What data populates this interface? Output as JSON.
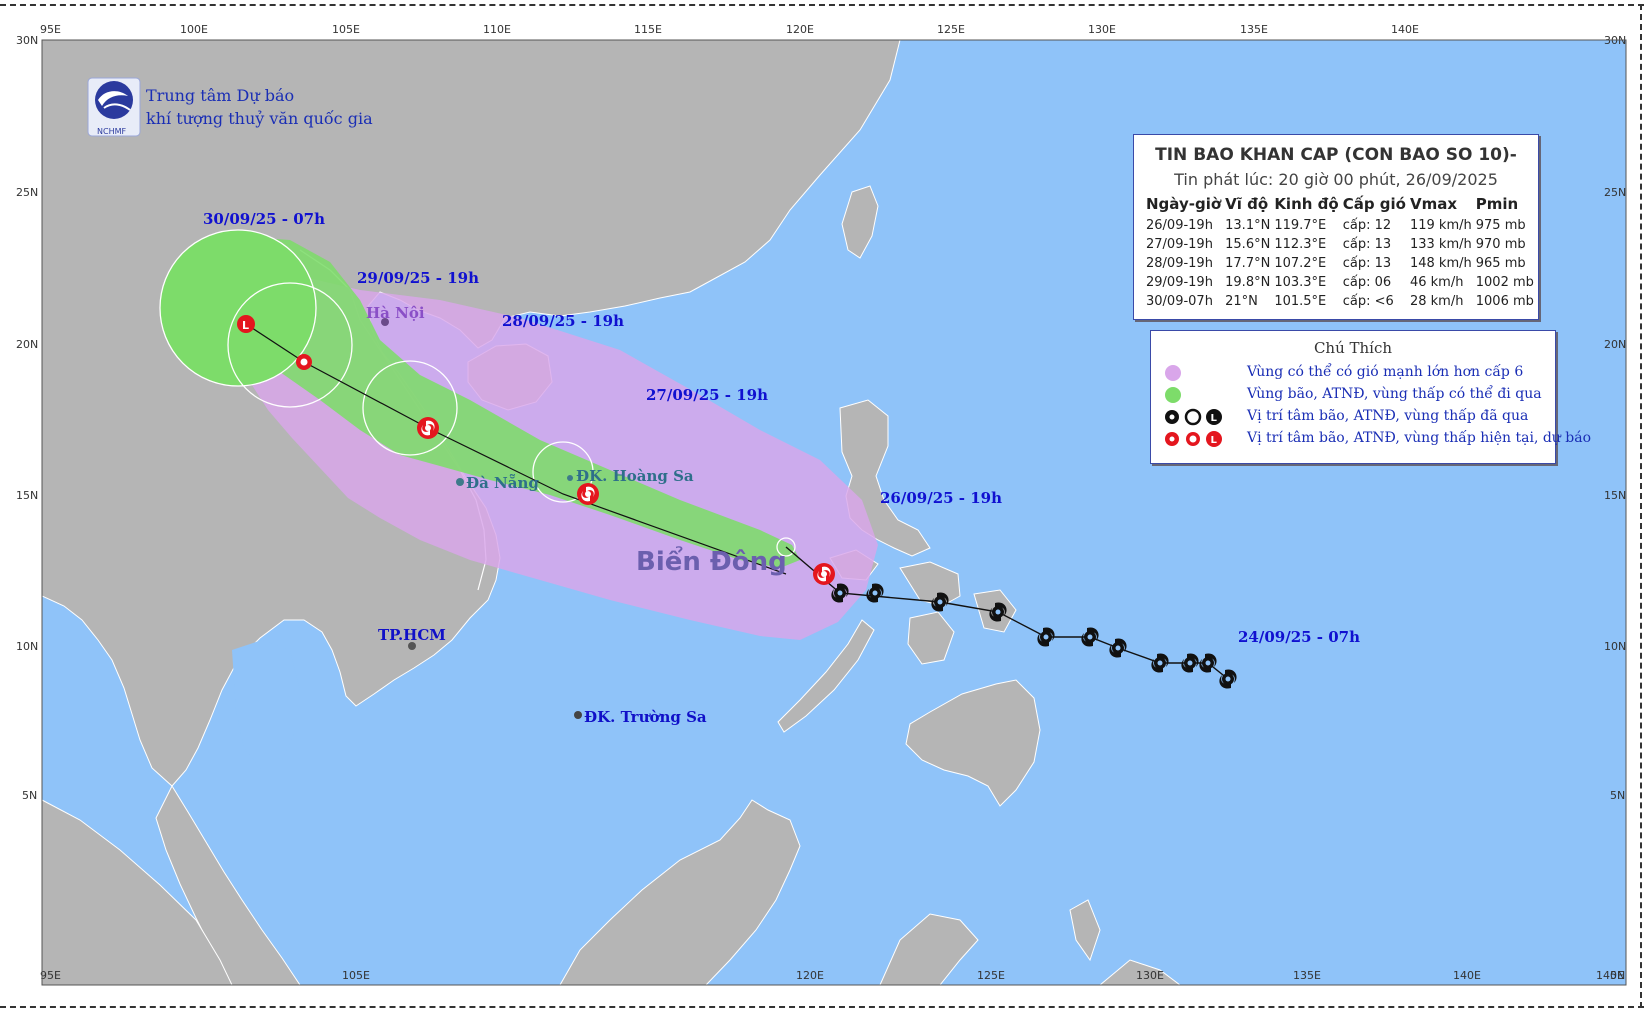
{
  "agency": {
    "line1": "Trung tâm Dự báo",
    "line2": "khí tượng thuỷ văn quốc gia",
    "logo_text": "NCHMF"
  },
  "axes": {
    "lon_ticks": [
      "95E",
      "100E",
      "105E",
      "110E",
      "115E",
      "120E",
      "125E",
      "130E",
      "135E",
      "140E"
    ],
    "lat_ticks_left": [
      "30N",
      "25N",
      "20N",
      "15N",
      "10N",
      "5N"
    ],
    "lat_ticks_right": [
      "30N",
      "25N",
      "20N",
      "15N",
      "10N",
      "5N",
      "0N"
    ],
    "bottom_ticks": [
      "95E",
      "105E",
      "120E",
      "125E",
      "130E",
      "135E",
      "140E",
      "145E"
    ]
  },
  "bulletin": {
    "title": "TIN BAO KHAN CAP (CON BAO SO 10)-",
    "issued": "Tin phát lúc: 20 giờ 00 phút, 26/09/2025",
    "headers": [
      "Ngày-giờ",
      "Vĩ độ",
      "Kinh độ",
      "Cấp gió",
      "Vmax",
      "Pmin"
    ],
    "rows": [
      [
        "26/09-19h",
        "13.1°N",
        "119.7°E",
        "cấp: 12",
        "119 km/h",
        "975 mb"
      ],
      [
        "27/09-19h",
        "15.6°N",
        "112.3°E",
        "cấp: 13",
        "133 km/h",
        "970 mb"
      ],
      [
        "28/09-19h",
        "17.7°N",
        "107.2°E",
        "cấp: 13",
        "148 km/h",
        "965 mb"
      ],
      [
        "29/09-19h",
        "19.8°N",
        "103.3°E",
        "cấp: 06",
        "46 km/h",
        "1002 mb"
      ],
      [
        "30/09-07h",
        "21°N",
        "101.5°E",
        "cấp: <6",
        "28 km/h",
        "1006 mb"
      ]
    ]
  },
  "legend": {
    "title": "Chú Thích",
    "items": [
      {
        "text": "Vùng có thể có gió mạnh lớn hơn cấp 6",
        "color": "#d9a6ea"
      },
      {
        "text": "Vùng bão, ATNĐ, vùng thấp có thể đi qua",
        "color": "#7ddc6a"
      },
      {
        "text": "Vị trí tâm bão, ATNĐ, vùng thấp đã qua",
        "color": "#111111"
      },
      {
        "text": "Vị trí tâm bão, ATNĐ, vùng thấp hiện tại, dự báo",
        "color": "#e4161e"
      }
    ]
  },
  "map_labels": {
    "d_30_09": "30/09/25 - 07h",
    "d_29_09": "29/09/25 - 19h",
    "d_28_09": "28/09/25 - 19h",
    "d_27_09": "27/09/25 - 19h",
    "d_26_09": "26/09/25 - 19h",
    "d_24_09": "24/09/25 - 07h",
    "hanoi": "Hà Nội",
    "danang": "Đà Nẵng",
    "hoangsa": "ĐK. Hoàng Sa",
    "hcm": "TP.HCM",
    "truongsa": "ĐK. Trường Sa",
    "sea": "Biển Đông"
  },
  "colors": {
    "ocean": "#8fc3f9",
    "land": "#b5b5b5",
    "danger_zone": "#d9a6ea",
    "cone": "#7ddc6a",
    "forecast_symbol": "#e4161e",
    "past_symbol": "#111111"
  }
}
